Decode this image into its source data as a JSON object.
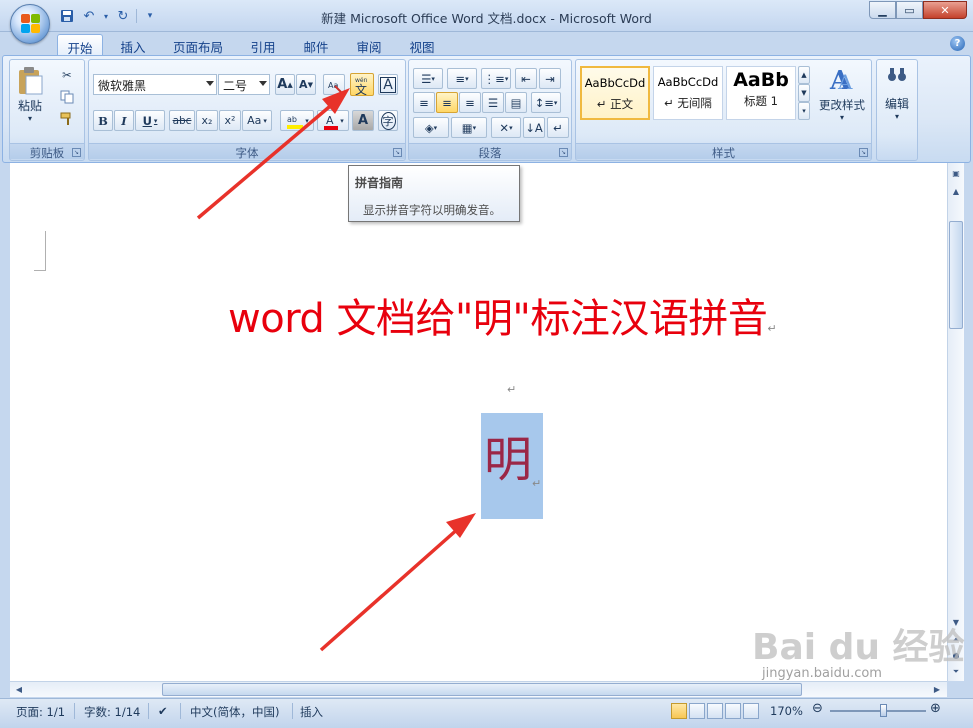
{
  "window": {
    "title": "新建 Microsoft Office Word 文档.docx - Microsoft Word",
    "min_icon": "minimize-icon",
    "max_icon": "maximize-icon",
    "close_icon": "close-icon"
  },
  "quick_access": {
    "save_icon": "save-icon",
    "undo_icon": "undo-icon",
    "redo_icon": "redo-icon",
    "customize_icon": "dropdown-icon"
  },
  "tabs": [
    "开始",
    "插入",
    "页面布局",
    "引用",
    "邮件",
    "审阅",
    "视图"
  ],
  "ribbon": {
    "clipboard": {
      "paste_label": "粘贴",
      "group_label": "剪贴板"
    },
    "font": {
      "font_name": "微软雅黑",
      "font_size": "二号",
      "group_label": "字体",
      "bold": "B",
      "italic": "I",
      "underline": "U",
      "strike": "abc",
      "subscript": "x₂",
      "superscript": "x²",
      "case": "Aa",
      "phonetic_guide_icon": "phonetic-guide-icon",
      "grow_font": "A",
      "shrink_font": "A",
      "char_border": "A",
      "char_shade": "A",
      "enclose": "字"
    },
    "paragraph": {
      "group_label": "段落"
    },
    "styles": {
      "group_label": "样式",
      "items": [
        {
          "sample": "AaBbCcDd",
          "name": "↵ 正文"
        },
        {
          "sample": "AaBbCcDd",
          "name": "↵ 无间隔"
        },
        {
          "sample": "AaBb",
          "name": "标题 1"
        }
      ],
      "change_styles_label": "更改样式"
    },
    "editing": {
      "label": "编辑"
    }
  },
  "tooltip": {
    "title": "拼音指南",
    "description": "显示拼音字符以明确发音。"
  },
  "document": {
    "heading": "word 文档给\"明\"标注汉语拼音",
    "paragraph_mark": "↵",
    "selected_char": "明"
  },
  "status_bar": {
    "page": "页面: 1/1",
    "words": "字数: 1/14",
    "language": "中文(简体，中国)",
    "mode": "插入",
    "zoom": "170%"
  },
  "watermark": {
    "logo": "Bai du 经验",
    "url": "jingyan.baidu.com"
  },
  "colors": {
    "heading": "#e8000d",
    "arrow": "#e8322a",
    "selection": "#a7c8ec",
    "selected_char": "#9b2747"
  }
}
